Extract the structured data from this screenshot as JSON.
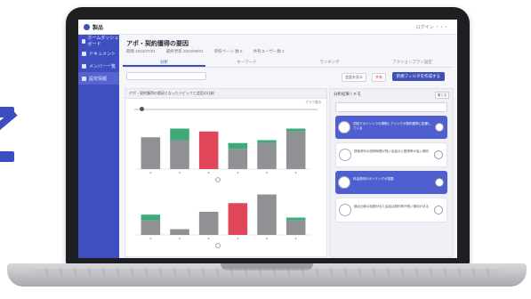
{
  "app": {
    "brand": "製品",
    "user_menu": "ログイン ・・・"
  },
  "sidebar": {
    "items": [
      {
        "label": "ホームダッシュボード",
        "active": false
      },
      {
        "label": "ドキュメント",
        "active": false
      },
      {
        "label": "メンバー一覧",
        "active": false
      },
      {
        "label": "設定情報",
        "active": true
      }
    ]
  },
  "page": {
    "title": "アポ・契約獲得の要因",
    "meta": [
      "期間 2022/07/01",
      "最終更新 2022/08/01",
      "参照ページ 数 5",
      "共有ユーザー数 2"
    ]
  },
  "tabs": [
    "分析",
    "キーワード",
    "ランキング",
    "アクションプラン設定"
  ],
  "toolbar": {
    "search_placeholder": "",
    "btn1": "会話を見る",
    "btn2": "共有",
    "primary": "新規フィルタを作成する"
  },
  "chart_panel": {
    "header": "アポ・契約獲得の要因となったトピックと会話の比較",
    "sub": "グラフ表示",
    "slider_value": 0.03
  },
  "side_panel": {
    "title": "分析結果 / メモ",
    "close_label": "閉じる",
    "comments": [
      {
        "text": "初回アポイントでの課題ヒアリングが契約獲得に影響している",
        "highlight": true
      },
      {
        "text": "提案資料の説明時間が長い会話ほど獲得率が高い傾向",
        "highlight": false
      },
      {
        "text": "料金説明のタイミングが重要",
        "highlight": true
      },
      {
        "text": "競合比較の話題が出た会話は契約率が低い傾向がある",
        "highlight": false
      }
    ]
  },
  "colors": {
    "accent": "#3f51b5",
    "sidebar": "#3f4fbf",
    "bar_gray": "#8f9195",
    "bar_green": "#3daa78",
    "bar_red": "#e0485a"
  },
  "chart_data": [
    {
      "type": "bar",
      "categories": [
        "1",
        "2",
        "3",
        "4",
        "5",
        "6"
      ],
      "series": [
        {
          "values": [
            22,
            20,
            0,
            14,
            18,
            26
          ]
        },
        {
          "values": [
            0,
            8,
            0,
            4,
            2,
            2
          ]
        },
        {
          "values": [
            0,
            0,
            26,
            0,
            0,
            0
          ]
        }
      ],
      "ylim": [
        0,
        32
      ]
    },
    {
      "type": "bar",
      "categories": [
        "1",
        "2",
        "3",
        "4",
        "5",
        "6"
      ],
      "series": [
        {
          "values": [
            10,
            4,
            16,
            0,
            28,
            10
          ]
        },
        {
          "values": [
            4,
            0,
            0,
            0,
            0,
            2
          ]
        },
        {
          "values": [
            0,
            0,
            0,
            22,
            0,
            0
          ]
        }
      ],
      "ylim": [
        0,
        32
      ]
    }
  ]
}
